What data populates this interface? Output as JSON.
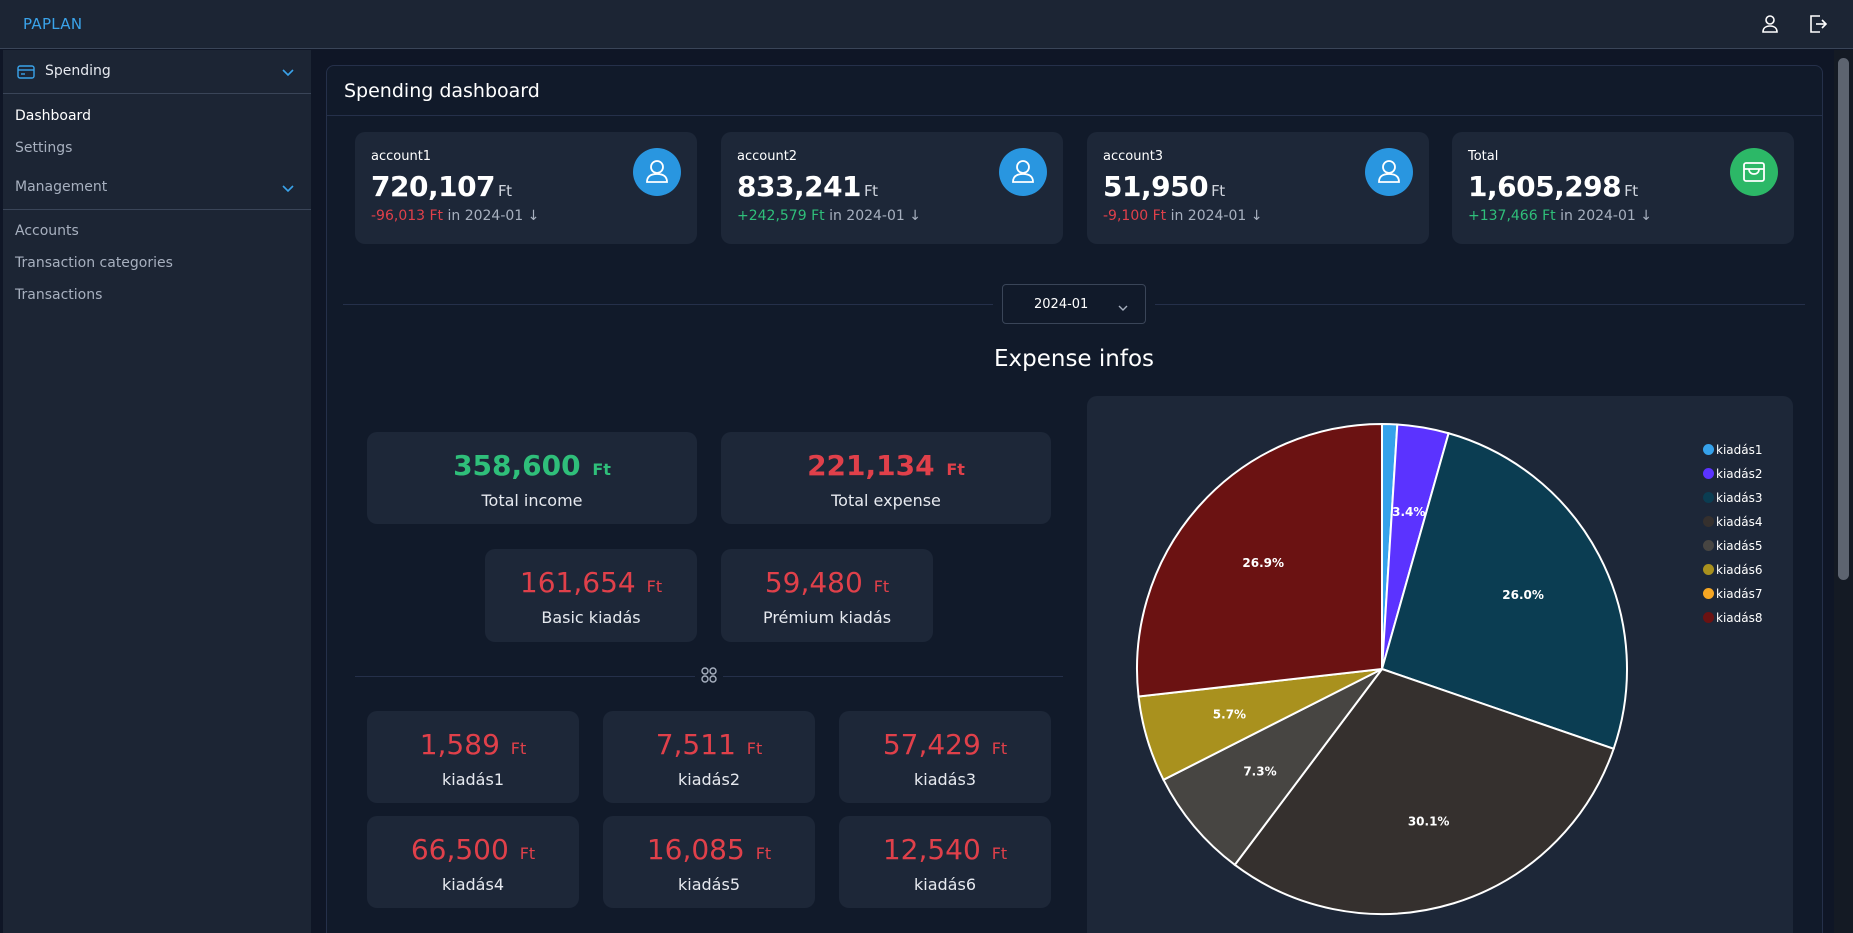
{
  "app": {
    "brand": "PAPLAN"
  },
  "sidebar": {
    "spending_group": "Spending",
    "spending_items": [
      "Dashboard",
      "Settings"
    ],
    "management_group": "Management",
    "management_items": [
      "Accounts",
      "Transaction categories",
      "Transactions"
    ]
  },
  "page": {
    "title": "Spending dashboard"
  },
  "accounts": [
    {
      "name": "account1",
      "amount": "720,107",
      "currency": "Ft",
      "delta": "-96,013 Ft",
      "delta_suffix": " in 2024-01 ↓",
      "trend": "negative",
      "icon": "user-icon"
    },
    {
      "name": "account2",
      "amount": "833,241",
      "currency": "Ft",
      "delta": "+242,579 Ft",
      "delta_suffix": " in 2024-01 ↓",
      "trend": "positive",
      "icon": "user-icon"
    },
    {
      "name": "account3",
      "amount": "51,950",
      "currency": "Ft",
      "delta": "-9,100 Ft",
      "delta_suffix": " in 2024-01 ↓",
      "trend": "negative",
      "icon": "user-icon"
    },
    {
      "name": "Total",
      "amount": "1,605,298",
      "currency": "Ft",
      "delta": "+137,466 Ft",
      "delta_suffix": " in 2024-01 ↓",
      "trend": "positive",
      "icon": "wallet-icon"
    }
  ],
  "month_select": {
    "value": "2024-01"
  },
  "expense_section": {
    "title": "Expense infos"
  },
  "totals": {
    "income": {
      "value": "358,600",
      "currency": "Ft",
      "label": "Total income"
    },
    "expense": {
      "value": "221,134",
      "currency": "Ft",
      "label": "Total expense"
    }
  },
  "kinds": [
    {
      "value": "161,654",
      "currency": "Ft",
      "label": "Basic kiadás"
    },
    {
      "value": "59,480",
      "currency": "Ft",
      "label": "Prémium kiadás"
    }
  ],
  "categories": [
    {
      "value": "1,589",
      "currency": "Ft",
      "label": "kiadás1"
    },
    {
      "value": "7,511",
      "currency": "Ft",
      "label": "kiadás2"
    },
    {
      "value": "57,429",
      "currency": "Ft",
      "label": "kiadás3"
    },
    {
      "value": "66,500",
      "currency": "Ft",
      "label": "kiadás4"
    },
    {
      "value": "16,085",
      "currency": "Ft",
      "label": "kiadás5"
    },
    {
      "value": "12,540",
      "currency": "Ft",
      "label": "kiadás6"
    }
  ],
  "colors": {
    "accent": "#3aa3ea",
    "income": "#2fbf7a",
    "expense": "#e0404a",
    "card_bg": "#1d2738",
    "panel_bg": "#111a2a"
  },
  "chart_data": {
    "type": "pie",
    "labels": [
      "kiadás1",
      "kiadás2",
      "kiadás3",
      "kiadás4",
      "kiadás5",
      "kiadás6",
      "kiadás7",
      "kiadás8"
    ],
    "values": [
      1.0,
      3.4,
      26.0,
      30.1,
      7.3,
      5.7,
      0.0,
      26.9
    ],
    "value_labels": [
      "",
      "3.4%",
      "26.0%",
      "30.1%",
      "7.3%",
      "5.7%",
      "",
      "26.9%"
    ],
    "colors": [
      "#36a2eb",
      "#5b33ff",
      "#0b3d52",
      "#35302e",
      "#474542",
      "#a9911e",
      "#f5a623",
      "#6b1212"
    ],
    "legend_position": "top-right"
  }
}
